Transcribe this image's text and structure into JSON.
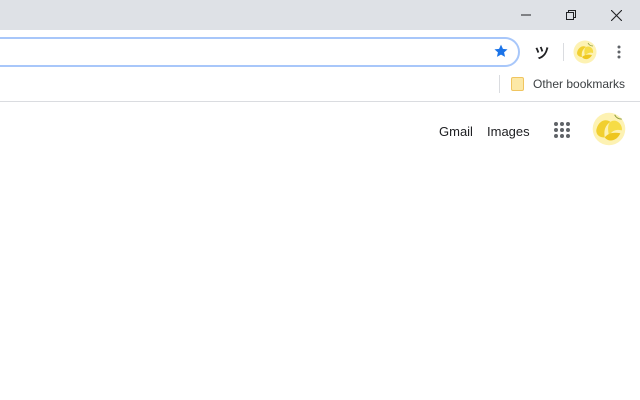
{
  "titlebar": {
    "buttons": [
      {
        "icon": "minimize-icon"
      },
      {
        "icon": "restore-icon"
      },
      {
        "icon": "close-icon"
      }
    ]
  },
  "toolbar": {
    "omnibox_value": "",
    "bookmark_star_icon": "star-icon",
    "bookmark_star_color": "#1a73e8",
    "extension_glyph": "ツ",
    "profile_icon": "profile-avatar",
    "menu_icon": "more-vert-icon"
  },
  "bookmarks_bar": {
    "other_bookmarks_label": "Other bookmarks",
    "folder_icon": "folder-icon"
  },
  "google_header": {
    "gmail_label": "Gmail",
    "images_label": "Images",
    "apps_icon": "apps-grid-icon",
    "account_icon": "profile-avatar"
  },
  "colors": {
    "titlebar_bg": "#dee1e6",
    "omnibox_focus_border": "#a8c7fa",
    "avatar_yellow": "#f5d63d"
  }
}
